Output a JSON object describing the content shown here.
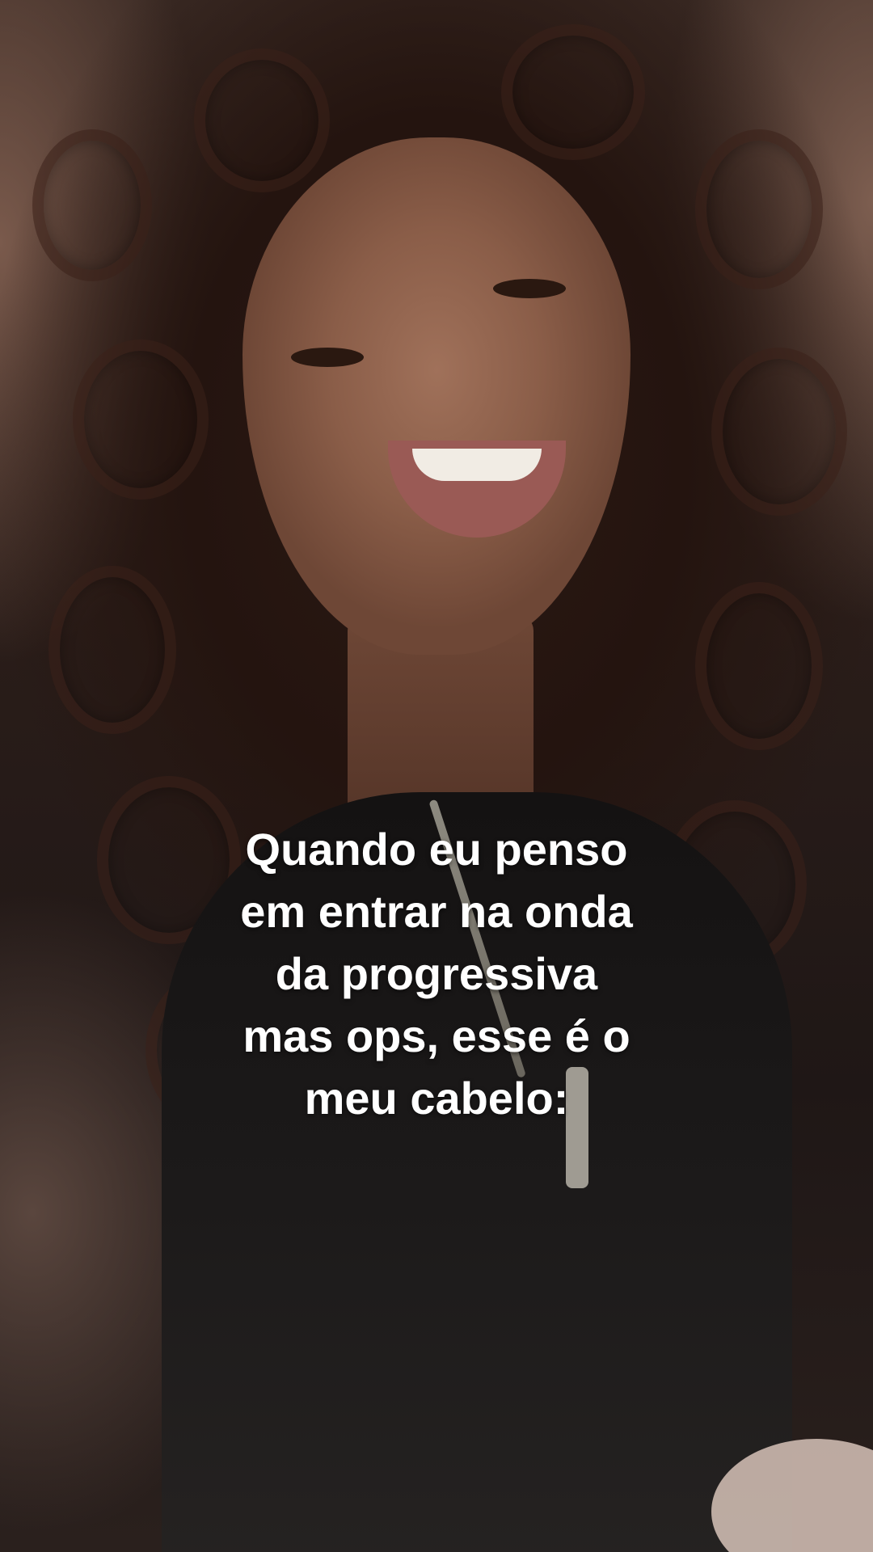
{
  "caption": {
    "lines": [
      "Quando eu penso",
      "em entrar na onda",
      "da progressiva",
      "mas ops, esse é o",
      "meu cabelo:"
    ]
  }
}
